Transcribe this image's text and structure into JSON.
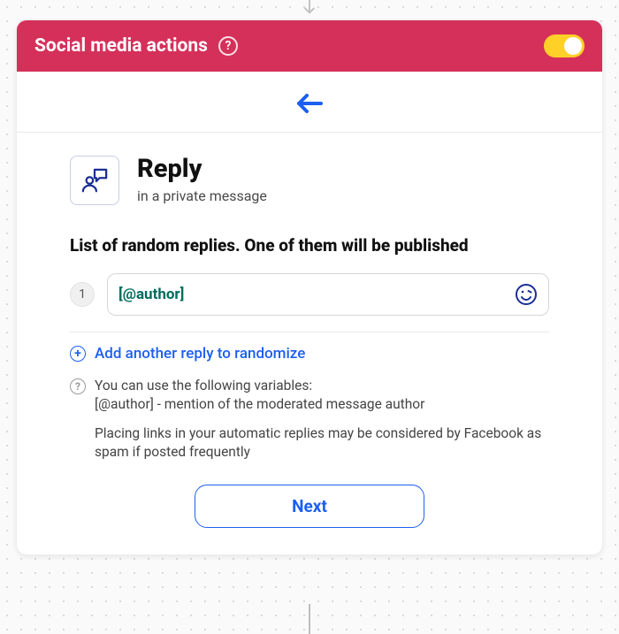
{
  "header": {
    "title": "Social media actions",
    "toggle_on": true
  },
  "reply": {
    "title": "Reply",
    "subtitle": "in a private message"
  },
  "list": {
    "title": "List of random replies. One of them will be published",
    "items": [
      {
        "index": "1",
        "value": "[@author]"
      }
    ]
  },
  "add_link": "Add another reply to randomize",
  "hint": {
    "line1": "You can use the following variables:",
    "line2": "[@author] - mention of the moderated message author",
    "line3": "Placing links in your automatic replies may be considered by Facebook as spam if posted frequently"
  },
  "next_label": "Next"
}
